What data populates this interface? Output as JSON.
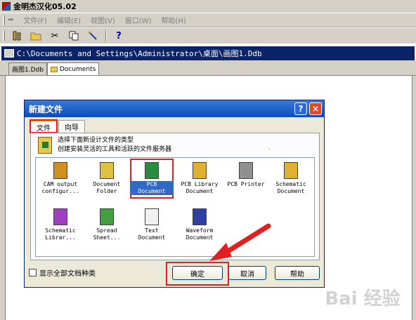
{
  "app": {
    "title": "金明杰汉化05.02"
  },
  "menubar": {
    "items": [
      "文件(F)",
      "编辑(E)",
      "视图(V)",
      "窗口(W)",
      "帮助(H)"
    ]
  },
  "toolbar": {
    "icons": [
      "project-tree-icon",
      "open-folder-icon",
      "cut-icon",
      "copy-icon",
      "pencil-icon",
      "help-question-icon"
    ],
    "help_glyph": "?"
  },
  "document": {
    "path": "C:\\Documents and Settings\\Administrator\\桌面\\画图1.Ddb",
    "tabs": [
      "画图1.Ddb",
      "Documents"
    ]
  },
  "dialog": {
    "title": "新建文件",
    "help_glyph": "?",
    "close_glyph": "×",
    "tabs": [
      "文件",
      "向导"
    ],
    "description": [
      "选择下面新设计文件的类型",
      "创建安装灵活的工具和活跃的文件服务器"
    ],
    "separator_text": ".",
    "files": [
      {
        "line1": "CAM output",
        "line2": "configur...",
        "icon": "cam-output-icon",
        "color": "#d09020"
      },
      {
        "line1": "Document",
        "line2": "Folder",
        "icon": "document-folder-icon",
        "color": "#e0c040"
      },
      {
        "line1": "PCB",
        "line2": "Document",
        "icon": "pcb-document-icon",
        "color": "#2a8a40",
        "selected": true
      },
      {
        "line1": "PCB Library",
        "line2": "Document",
        "icon": "pcb-library-icon",
        "color": "#e0b030"
      },
      {
        "line1": "PCB Printer",
        "line2": "",
        "icon": "pcb-printer-icon",
        "color": "#909090"
      },
      {
        "line1": "Schematic",
        "line2": "Document",
        "icon": "schematic-document-icon",
        "color": "#e0b030"
      },
      {
        "line1": "Schematic",
        "line2": "Librar...",
        "icon": "schematic-library-icon",
        "color": "#a040c0"
      },
      {
        "line1": "Spread",
        "line2": "Sheet...",
        "icon": "spreadsheet-icon",
        "color": "#40a040"
      },
      {
        "line1": "Text",
        "line2": "Document",
        "icon": "text-document-icon",
        "color": "#f0f0f0"
      },
      {
        "line1": "Waveform",
        "line2": "Document",
        "icon": "waveform-document-icon",
        "color": "#3040a0"
      }
    ],
    "show_all_label": "显示全部文档种类",
    "ok_label": "确定",
    "cancel_label": "取消",
    "help_label": "帮助"
  },
  "annotations": {
    "highlight_color": "#e02020"
  },
  "watermark": {
    "text": "Bai 经验"
  }
}
